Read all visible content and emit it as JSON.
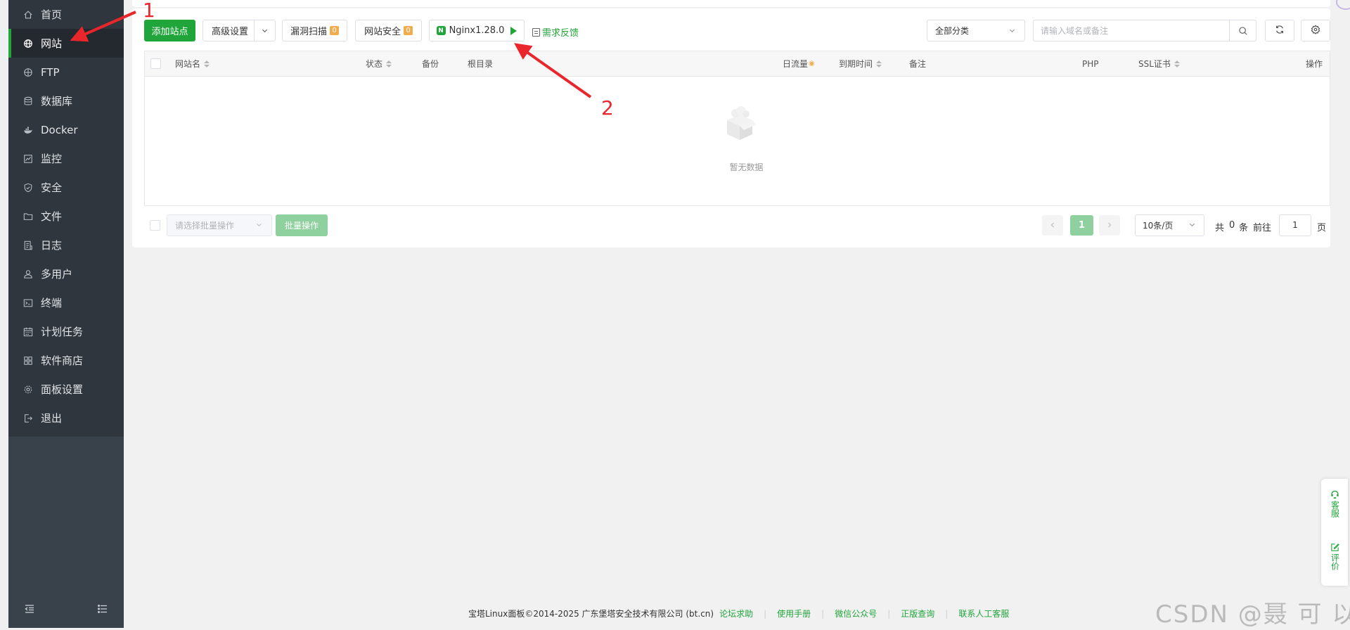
{
  "sidebar": {
    "items": [
      {
        "label": "首页",
        "icon": "home-icon"
      },
      {
        "label": "网站",
        "icon": "globe-icon"
      },
      {
        "label": "FTP",
        "icon": "ftp-icon"
      },
      {
        "label": "数据库",
        "icon": "database-icon"
      },
      {
        "label": "Docker",
        "icon": "docker-icon"
      },
      {
        "label": "监控",
        "icon": "monitor-icon"
      },
      {
        "label": "安全",
        "icon": "shield-icon"
      },
      {
        "label": "文件",
        "icon": "folder-icon"
      },
      {
        "label": "日志",
        "icon": "log-icon"
      },
      {
        "label": "多用户",
        "icon": "users-icon"
      },
      {
        "label": "终端",
        "icon": "terminal-icon"
      },
      {
        "label": "计划任务",
        "icon": "calendar-icon"
      },
      {
        "label": "软件商店",
        "icon": "grid-icon"
      },
      {
        "label": "面板设置",
        "icon": "gear-icon"
      },
      {
        "label": "退出",
        "icon": "logout-icon"
      }
    ],
    "active_index": 1
  },
  "toolbar": {
    "add_site": "添加站点",
    "advanced": "高级设置",
    "vuln_scan": "漏洞扫描",
    "vuln_count": "0",
    "site_security": "网站安全",
    "security_count": "0",
    "nginx": "Nginx1.28.0",
    "feedback": "需求反馈",
    "category": "全部分类",
    "search_placeholder": "请输入域名或备注"
  },
  "table": {
    "columns": [
      "网站名",
      "状态",
      "备份",
      "根目录",
      "日流量",
      "到期时间",
      "备注",
      "PHP",
      "SSL证书",
      "操作"
    ],
    "empty_text": "暂无数据"
  },
  "footer": {
    "batch_placeholder": "请选择批量操作",
    "batch_button": "批量操作",
    "current_page": "1",
    "page_size": "10条/页",
    "total_prefix": "共",
    "total": "0",
    "total_suffix": "条",
    "goto_label": "前往",
    "goto_page": "1",
    "page_suffix": "页"
  },
  "side_widget": {
    "service": "客服",
    "review": "评价"
  },
  "copyright": {
    "text": "宝塔Linux面板©2014-2025 广东堡塔安全技术有限公司 (bt.cn)",
    "links": [
      "论坛求助",
      "使用手册",
      "微信公众号",
      "正版查询",
      "联系人工客服"
    ]
  },
  "annotations": {
    "one": "1",
    "two": "2",
    "color": "#e8262b"
  },
  "watermark": "CSDN @聂 可 以",
  "colors": {
    "accent": "#20a53a",
    "sidebar": "#2f363e",
    "badge": "#f0ad4e"
  }
}
